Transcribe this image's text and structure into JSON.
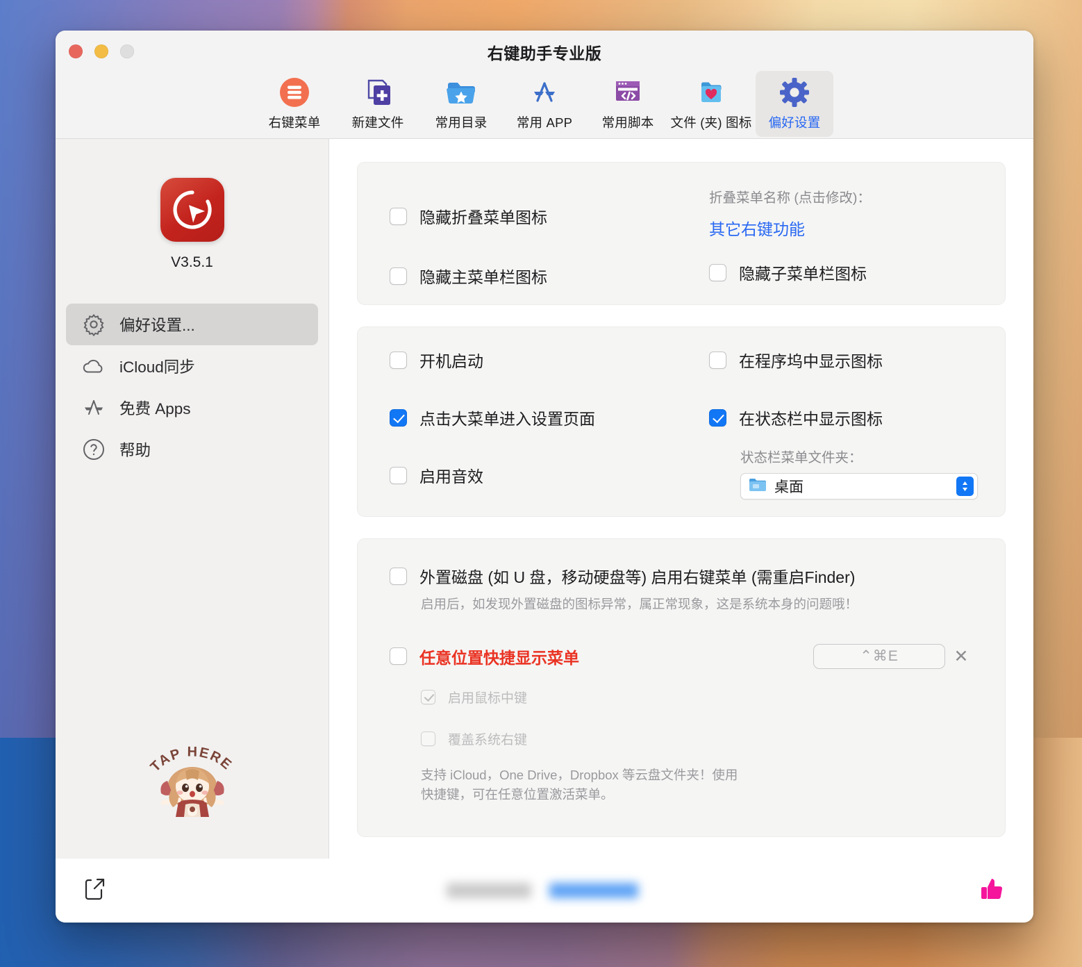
{
  "window": {
    "title": "右键助手专业版",
    "traffic_lights": [
      "close",
      "minimize",
      "zoom"
    ]
  },
  "toolbar": {
    "items": [
      {
        "label": "右键菜单",
        "icon": "hamburger-circle-icon",
        "active": false
      },
      {
        "label": "新建文件",
        "icon": "new-file-plus-icon",
        "active": false
      },
      {
        "label": "常用目录",
        "icon": "folder-star-icon",
        "active": false
      },
      {
        "label": "常用 APP",
        "icon": "app-store-icon",
        "active": false
      },
      {
        "label": "常用脚本",
        "icon": "script-code-window-icon",
        "active": false
      },
      {
        "label": "文件 (夹) 图标",
        "icon": "folder-heart-icon",
        "active": false
      },
      {
        "label": "偏好设置",
        "icon": "gear-icon",
        "active": true
      }
    ]
  },
  "sidebar": {
    "app_icon": "cursor-logo-icon",
    "version": "V3.5.1",
    "items": [
      {
        "label": "偏好设置...",
        "icon": "gear-icon",
        "active": true
      },
      {
        "label": "iCloud同步",
        "icon": "cloud-icon",
        "active": false
      },
      {
        "label": "免费 Apps",
        "icon": "app-store-icon",
        "active": false
      },
      {
        "label": "帮助",
        "icon": "question-circle-icon",
        "active": false
      }
    ],
    "mascot": {
      "caption": "TAP HERE"
    }
  },
  "main": {
    "card1": {
      "hide_collapse_menu_icon": {
        "label": "隐藏折叠菜单图标",
        "checked": false
      },
      "hide_main_menu_icon": {
        "label": "隐藏主菜单栏图标",
        "checked": false
      },
      "collapse_menu_name_label": "折叠菜单名称 (点击修改)：",
      "collapse_menu_name_value": "其它右键功能",
      "hide_sub_menu_icon": {
        "label": "隐藏子菜单栏图标",
        "checked": false
      }
    },
    "card2": {
      "launch_at_login": {
        "label": "开机启动",
        "checked": false
      },
      "big_menu_opens_settings": {
        "label": "点击大菜单进入设置页面",
        "checked": true
      },
      "enable_sound": {
        "label": "启用音效",
        "checked": false
      },
      "show_in_dock": {
        "label": "在程序坞中显示图标",
        "checked": false
      },
      "show_in_status_bar": {
        "label": "在状态栏中显示图标",
        "checked": true
      },
      "status_bar_folder_label": "状态栏菜单文件夹：",
      "status_bar_folder_value": "桌面"
    },
    "card3": {
      "external_disk": {
        "label": "外置磁盘 (如 U 盘，移动硬盘等) 启用右键菜单 (需重启Finder)",
        "checked": false,
        "hint": "启用后，如发现外置磁盘的图标异常，属正常现象，这是系统本身的问题哦！"
      },
      "anywhere_shortcut": {
        "label": "任意位置快捷显示菜单",
        "checked": false,
        "shortcut_value": "⌃⌘E",
        "clear_label": "✕"
      },
      "enable_middle_click": {
        "label": "启用鼠标中键",
        "checked": true,
        "disabled": true
      },
      "override_system_right_click": {
        "label": "覆盖系统右键",
        "checked": false,
        "disabled": true
      },
      "cloud_hint_line1": "支持 iCloud，One Drive，Dropbox 等云盘文件夹！使用",
      "cloud_hint_line2": "快捷键，可在任意位置激活菜单。"
    }
  },
  "footer": {
    "share_icon": "share-export-icon",
    "like_icon": "thumbs-up-icon",
    "redacted_label_1": "",
    "redacted_label_2": ""
  },
  "colors": {
    "accent_blue": "#1277f5",
    "link_blue": "#2968f2",
    "alert_red": "#ea3323",
    "like_pink": "#f5159c"
  }
}
